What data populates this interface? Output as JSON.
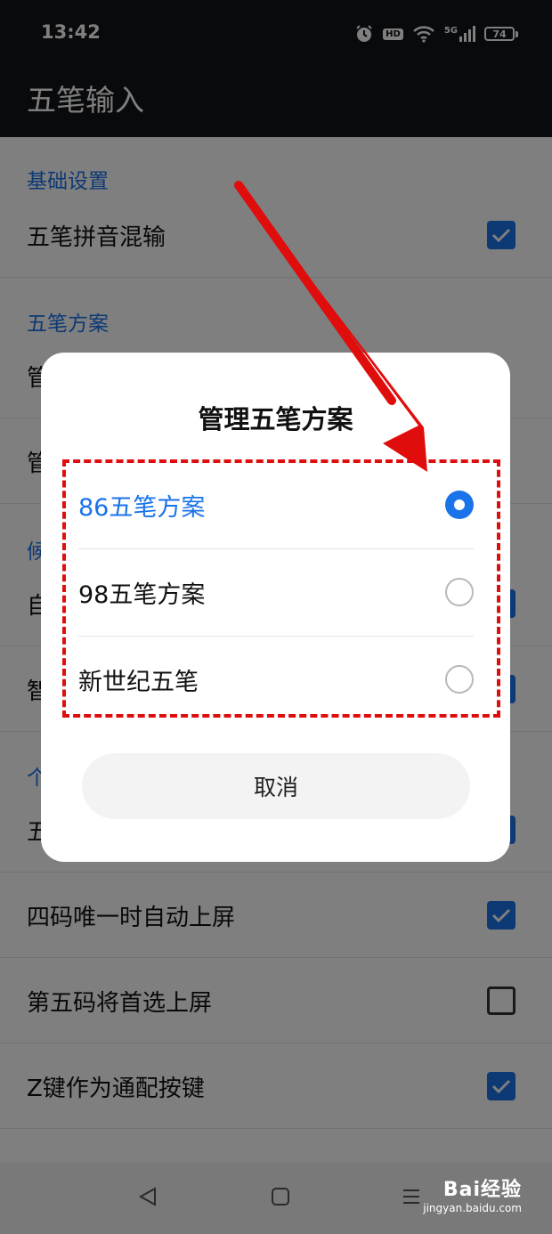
{
  "status_bar": {
    "time": "13:42",
    "hd_label": "HD",
    "network_label": "5G",
    "battery_level": "74",
    "icons": [
      "alarm-icon",
      "hd-icon",
      "wifi-icon",
      "signal-icon",
      "battery-icon"
    ]
  },
  "app_bar": {
    "title": "五笔输入"
  },
  "settings": {
    "sections": [
      {
        "header": "基础设置"
      },
      {
        "header": "五笔方案"
      },
      {
        "header": "候"
      },
      {
        "header": "个"
      }
    ],
    "rows": [
      {
        "label": "五笔拼音混输",
        "checked": true
      },
      {
        "label": "管"
      },
      {
        "label": "管"
      },
      {
        "label": "自",
        "checked": true
      },
      {
        "label": "智",
        "checked": true
      },
      {
        "label": "五",
        "checked": true
      },
      {
        "label": "四码唯一时自动上屏",
        "checked": true
      },
      {
        "label": "第五码将首选上屏",
        "checked": false
      },
      {
        "label": "Z键作为通配按键",
        "checked": true
      }
    ]
  },
  "dialog": {
    "title": "管理五笔方案",
    "options": [
      {
        "label": "86五笔方案",
        "selected": true
      },
      {
        "label": "98五笔方案",
        "selected": false
      },
      {
        "label": "新世纪五笔",
        "selected": false
      }
    ],
    "cancel_label": "取消"
  },
  "nav_bar": {
    "icons": [
      "back-icon",
      "home-icon",
      "menu-icon"
    ]
  },
  "watermark": {
    "main": "Bai经验",
    "sub": "jingyan.baidu.com"
  },
  "colors": {
    "accent": "#1a73e8",
    "annotation": "#e00d0d",
    "app_bar": "#111418",
    "scrim": "rgba(0,0,0,0.5)"
  }
}
